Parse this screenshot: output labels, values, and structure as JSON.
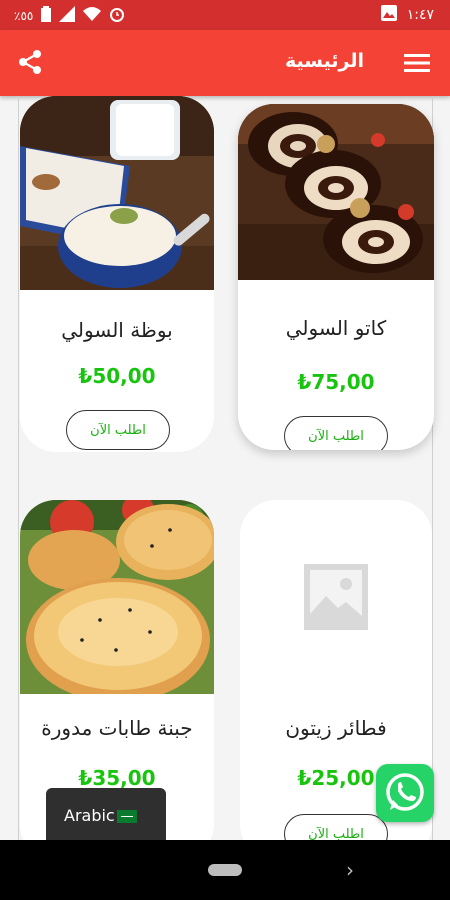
{
  "status_bar": {
    "time": "١:٤٧",
    "battery_text": "٪٥٥"
  },
  "app_bar": {
    "title": "الرئيسية",
    "menu_icon": "hamburger-menu-icon",
    "share_icon": "share-icon"
  },
  "products": [
    {
      "name": "كاتو السولي",
      "price": "₺75,00",
      "order_label": "اطلب الآن"
    },
    {
      "name": "بوظة السولي",
      "price": "₺50,00",
      "order_label": "اطلب الآن"
    },
    {
      "name": "فطائر زيتون",
      "price": "₺25,00",
      "order_label": "اطلب الآن"
    },
    {
      "name": "جبنة طابات مدورة",
      "price": "₺35,00",
      "order_label": ""
    }
  ],
  "language_switcher": {
    "label": "Arabic"
  },
  "colors": {
    "app_bar": "#f44336",
    "status_bar": "#d32f2f",
    "price": "#19c40f",
    "whatsapp": "#25d366"
  }
}
